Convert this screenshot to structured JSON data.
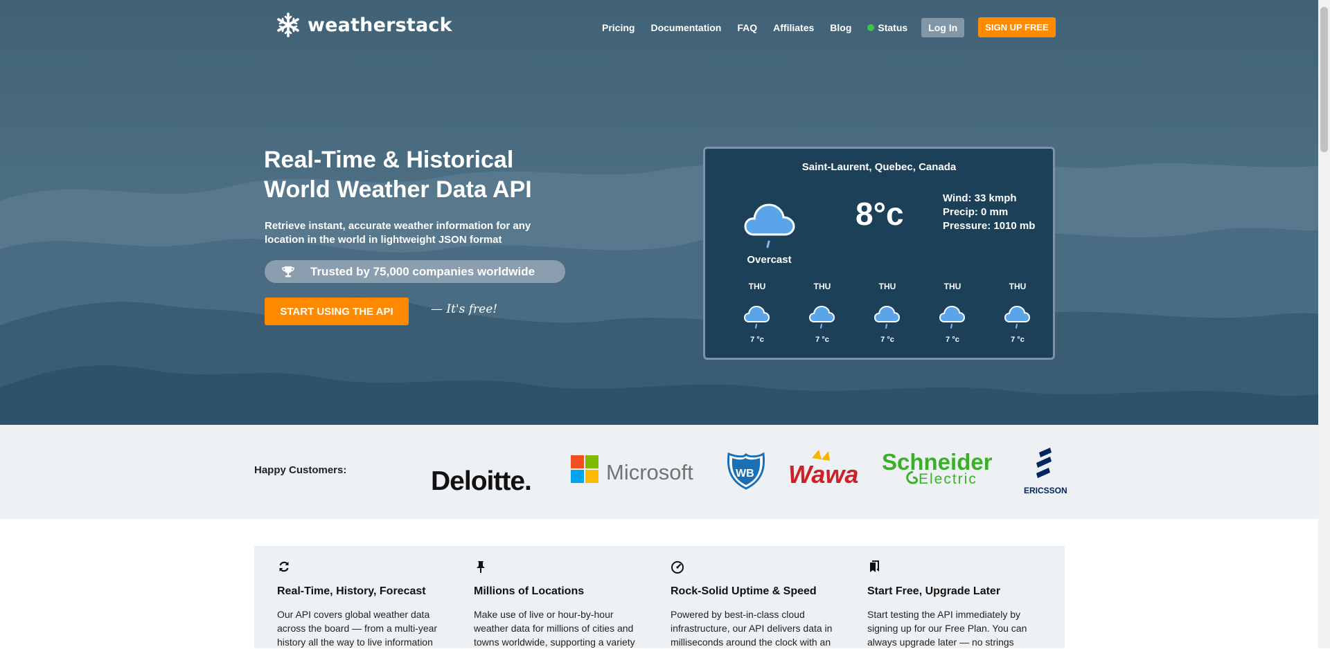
{
  "brand": {
    "name": "weatherstack"
  },
  "nav": {
    "links": [
      "Pricing",
      "Documentation",
      "FAQ",
      "Affiliates",
      "Blog"
    ],
    "status_label": "Status",
    "status_color": "#3ec44a",
    "login_label": "Log In",
    "signup_label": "SIGN UP FREE"
  },
  "hero": {
    "title_line1": "Real-Time & Historical",
    "title_line2": "World Weather Data API",
    "subtitle_line1": "Retrieve instant, accurate weather information for any",
    "subtitle_line2": "location in the world in lightweight JSON format",
    "trusted": "Trusted by 75,000 companies worldwide",
    "cta_label": "START USING THE API",
    "free_note": "— It's free!",
    "accent_color": "#ff8a00"
  },
  "widget": {
    "location": "Saint-Laurent, Quebec, Canada",
    "condition": "Overcast",
    "temperature": "8°c",
    "wind": "Wind: 33 kmph",
    "precip": "Precip: 0 mm",
    "pressure": "Pressure: 1010 mb",
    "forecast": [
      {
        "day": "THU",
        "temp": "7 °c"
      },
      {
        "day": "THU",
        "temp": "7 °c"
      },
      {
        "day": "THU",
        "temp": "7 °c"
      },
      {
        "day": "THU",
        "temp": "7 °c"
      },
      {
        "day": "THU",
        "temp": "7 °c"
      }
    ]
  },
  "customers": {
    "label": "Happy Customers:",
    "logos": [
      "Deloitte.",
      "Microsoft",
      "WB",
      "Wawa",
      "Schneider",
      "Electric",
      "ERICSSON"
    ]
  },
  "features": [
    {
      "icon": "refresh-icon",
      "title": "Real-Time, History, Forecast",
      "line1": "Our API covers global weather data",
      "line2": "across the board — from a multi-year",
      "line3": "history all the way to live information"
    },
    {
      "icon": "pin-icon",
      "title": "Millions of Locations",
      "line1": "Make use of live or hour-by-hour",
      "line2": "weather data for millions of cities and",
      "line3": "towns worldwide, supporting a variety"
    },
    {
      "icon": "speedometer-icon",
      "title": "Rock-Solid Uptime & Speed",
      "line1": "Powered by best-in-class cloud",
      "line2": "infrastructure, our API delivers data in",
      "line3": "milliseconds around the clock with an"
    },
    {
      "icon": "bookmark-icon",
      "title": "Start Free, Upgrade Later",
      "line1": "Start testing the API immediately by",
      "line2": "signing up for our Free Plan. You can",
      "line3": "always upgrade later — no strings"
    }
  ]
}
